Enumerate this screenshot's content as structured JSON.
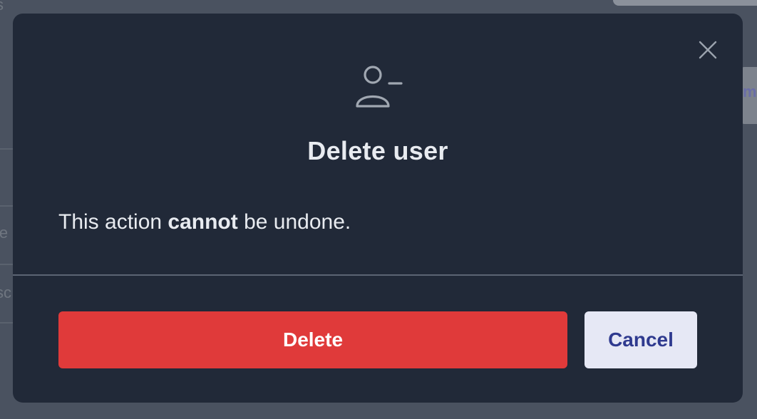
{
  "background": {
    "top_left_text": "s",
    "left_text_1": "le",
    "left_text_2": "sc",
    "right_text": "m"
  },
  "modal": {
    "icon": "user-minus-icon",
    "close_icon": "close-icon",
    "title": "Delete user",
    "message_prefix": "This action ",
    "message_bold": "cannot",
    "message_suffix": " be undone.",
    "delete_label": "Delete",
    "cancel_label": "Cancel"
  },
  "colors": {
    "modal_bg": "#212938",
    "danger": "#e03a3a",
    "cancel_bg": "#e6e8f5",
    "cancel_text": "#2f3a8f",
    "overlay": "#4a5260"
  }
}
